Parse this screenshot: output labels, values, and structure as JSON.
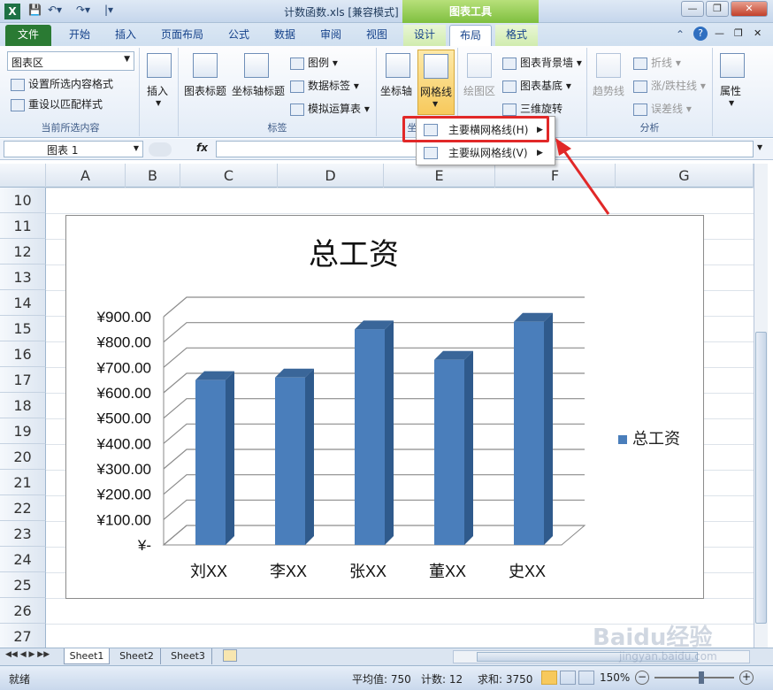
{
  "window": {
    "title": "计数函数.xls  [兼容模式] - Microsoft Excel",
    "context_tab_group": "图表工具",
    "excel_logo": "X",
    "qat_separator": "|▾"
  },
  "tabs": [
    "文件",
    "开始",
    "插入",
    "页面布局",
    "公式",
    "数据",
    "审阅",
    "视图",
    "设计",
    "布局",
    "格式"
  ],
  "active_tab": "布局",
  "ribbon": {
    "current_selection": {
      "dropdown_value": "图表区",
      "format_selection": "设置所选内容格式",
      "reset_style": "重设以匹配样式",
      "group_label": "当前所选内容"
    },
    "insert": {
      "label": "插入"
    },
    "labels": {
      "chart_title": "图表标题",
      "axis_title": "坐标轴标题",
      "legend": "图例",
      "data_labels": "数据标签",
      "data_table": "模拟运算表",
      "group_label": "标签"
    },
    "axes": {
      "axes": "坐标轴",
      "gridlines": "网格线",
      "group_label": "坐标"
    },
    "background": {
      "plot_area": "绘图区",
      "chart_wall": "图表背景墙",
      "chart_floor": "图表基底",
      "rotation": "三维旋转"
    },
    "analysis": {
      "trendline": "趋势线",
      "lines": "折线",
      "updown_bars": "涨/跌柱线",
      "error_bars": "误差线",
      "group_label": "分析"
    },
    "properties": {
      "label": "属性"
    }
  },
  "gridlines_menu": {
    "items": [
      {
        "label": "主要横网格线(H)"
      },
      {
        "label": "主要纵网格线(V)"
      }
    ]
  },
  "formula_bar": {
    "name_box": "图表  1",
    "fx": "fx"
  },
  "columns": [
    "A",
    "B",
    "C",
    "D",
    "E",
    "F",
    "G"
  ],
  "rows": [
    "10",
    "11",
    "12",
    "13",
    "14",
    "15",
    "16",
    "17",
    "18",
    "19",
    "20",
    "21",
    "22",
    "23",
    "24",
    "25",
    "26",
    "27"
  ],
  "chart_data": {
    "type": "bar",
    "title": "总工资",
    "categories": [
      "刘XX",
      "李XX",
      "张XX",
      "董XX",
      "史XX"
    ],
    "series": [
      {
        "name": "总工资",
        "values": [
          650,
          660,
          850,
          730,
          880
        ],
        "color": "#4a7ebb"
      }
    ],
    "ylim": [
      0,
      900
    ],
    "y_ticks": [
      "¥-",
      "¥100.00",
      "¥200.00",
      "¥300.00",
      "¥400.00",
      "¥500.00",
      "¥600.00",
      "¥700.00",
      "¥800.00",
      "¥900.00"
    ],
    "grid": true,
    "legend_position": "right",
    "three_d": true
  },
  "sheets": [
    "Sheet1",
    "Sheet2",
    "Sheet3"
  ],
  "status": {
    "ready": "就绪",
    "average": "平均值: 750",
    "count": "计数: 12",
    "sum": "求和: 3750",
    "zoom": "150%"
  },
  "watermark": {
    "brand": "Baidu经验",
    "url": "jingyan.baidu.com"
  }
}
